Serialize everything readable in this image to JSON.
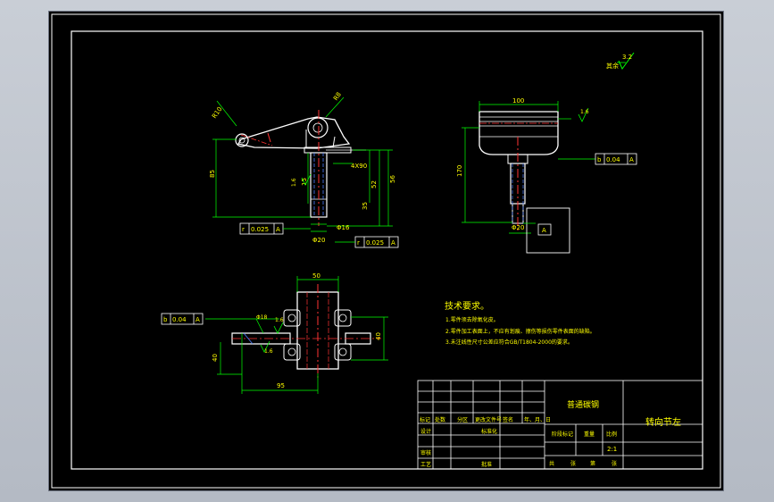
{
  "roughness": {
    "value": "3.2",
    "label": "其余"
  },
  "front_view": {
    "dim_top_radius": "R10",
    "dim_hole": "R8",
    "dim_height_main": "85",
    "dim_15": "15",
    "dim_thread": "4X90",
    "dim_52": "52",
    "dim_56": "56",
    "dim_35": "35",
    "dim_phi16": "Φ16",
    "dim_phi20": "Φ20",
    "rough_left": "1.6",
    "tol1_symbol": "r",
    "tol1_value": "0.025",
    "tol1_datum": "A",
    "tol2_symbol": "r",
    "tol2_value": "0.025",
    "tol2_datum": "A"
  },
  "side_view": {
    "dim_width": "100",
    "dim_height": "170",
    "dim_phi": "Φ20",
    "rough": "1.6",
    "tol_symbol": "b",
    "tol_value": "0.04",
    "tol_datum": "A",
    "datum_label": "A"
  },
  "top_view": {
    "dim_top": "50",
    "dim_phi18": "Φ18",
    "rough1": "1.6",
    "rough2": "1.6",
    "dim_left": "40",
    "dim_right": "40",
    "dim_bottom": "95",
    "tol_symbol": "b",
    "tol_value": "0.04",
    "tol_datum": "A"
  },
  "tech_requirements": {
    "title": "技术要求。",
    "items": [
      "1.零件须去除氧化皮。",
      "2.零件加工表面上，不应有划痕、擦伤等损伤零件表面的缺陷。",
      "3.未注线性尺寸公差应符合GB/T1804-2000的要求。"
    ]
  },
  "title_block": {
    "material": "普通碳钢",
    "part_name": "转向节左",
    "row_labels": [
      "标记",
      "处数",
      "分区",
      "更改文件号",
      "签名",
      "年、月、日"
    ],
    "design": "设计",
    "standardize": "标准化",
    "check": "审核",
    "process": "工艺",
    "approve": "批准",
    "stage_mark": "阶段标记",
    "weight": "重量",
    "scale_label": "比例",
    "scale": "2:1",
    "sheets": [
      "共",
      "张",
      "第",
      "张"
    ]
  },
  "colors": {
    "background": "#000000",
    "lines": "#ffffff",
    "dimensions": "#00ff00",
    "centerline": "#ff3333",
    "hidden": "#4d7dff",
    "text_yellow": "#ffff00"
  }
}
